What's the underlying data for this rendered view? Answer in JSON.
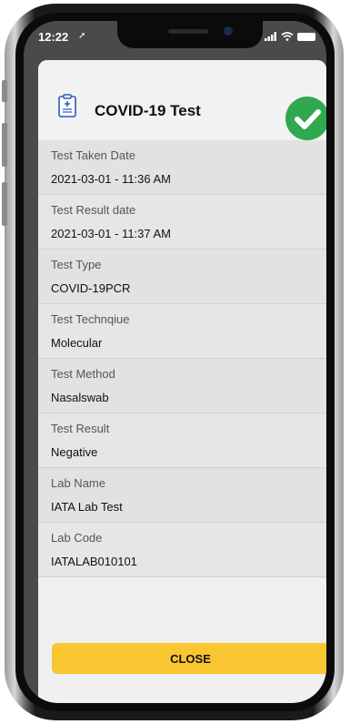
{
  "status_bar": {
    "time": "12:22"
  },
  "header": {
    "title": "COVID-19 Test"
  },
  "details": [
    {
      "label": "Test Taken Date",
      "value": "2021-03-01 - 11:36 AM"
    },
    {
      "label": "Test Result date",
      "value": "2021-03-01 - 11:37 AM"
    },
    {
      "label": "Test Type",
      "value": "COVID-19PCR"
    },
    {
      "label": "Test Technqiue",
      "value": "Molecular"
    },
    {
      "label": "Test Method",
      "value": "Nasalswab"
    },
    {
      "label": "Test Result",
      "value": "Negative"
    },
    {
      "label": "Lab Name",
      "value": "IATA Lab Test"
    },
    {
      "label": "Lab Code",
      "value": "IATALAB010101"
    }
  ],
  "footer": {
    "close_label": "CLOSE"
  },
  "colors": {
    "accent": "#f9c531",
    "success": "#2fa84f"
  },
  "icons": {
    "header": "clipboard-medical-icon",
    "status": "check-circle-icon"
  }
}
